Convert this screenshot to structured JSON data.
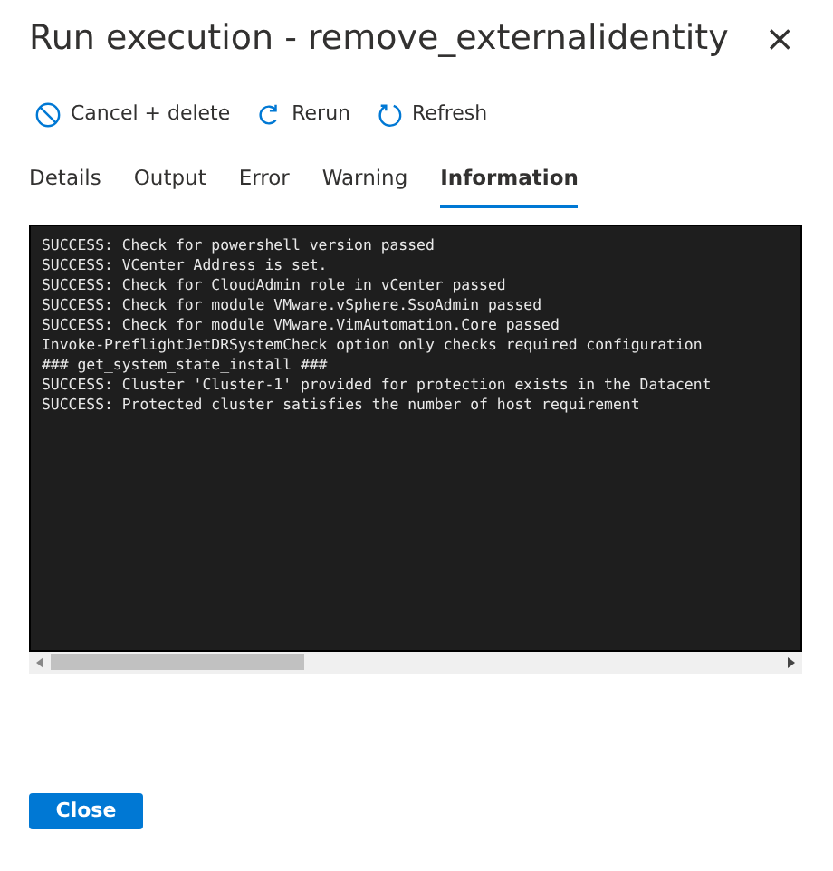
{
  "dialog": {
    "title": "Run execution - remove_externalidentity",
    "close_glyph": "×"
  },
  "toolbar": [
    {
      "kind": "cancel",
      "label": "Cancel + delete"
    },
    {
      "kind": "rerun",
      "label": "Rerun"
    },
    {
      "kind": "refresh",
      "label": "Refresh"
    }
  ],
  "tabs": [
    {
      "label": "Details",
      "selected": false
    },
    {
      "label": "Output",
      "selected": false
    },
    {
      "label": "Error",
      "selected": false
    },
    {
      "label": "Warning",
      "selected": false
    },
    {
      "label": "Information",
      "selected": true
    }
  ],
  "console_lines": [
    "SUCCESS: Check for powershell version passed",
    "SUCCESS: VCenter Address is set.",
    "SUCCESS: Check for CloudAdmin role in vCenter passed",
    "SUCCESS: Check for module VMware.vSphere.SsoAdmin passed",
    "SUCCESS: Check for module VMware.VimAutomation.Core passed",
    "Invoke-PreflightJetDRSystemCheck option only checks required configuration",
    "### get_system_state_install ###",
    "SUCCESS: Cluster 'Cluster-1' provided for protection exists in the Datacent",
    "SUCCESS: Protected cluster satisfies the number of host requirement"
  ],
  "close_button": "Close"
}
